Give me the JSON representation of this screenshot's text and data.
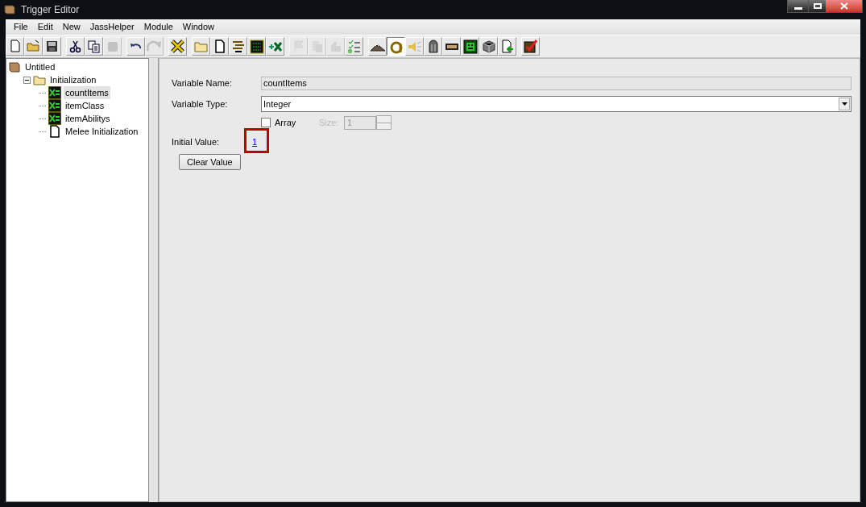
{
  "window": {
    "title": "Trigger Editor"
  },
  "menu": [
    "File",
    "Edit",
    "New",
    "JassHelper",
    "Module",
    "Window"
  ],
  "toolbar": [
    [
      {
        "kind": "new",
        "disabled": false,
        "pressed": false
      },
      {
        "kind": "open",
        "disabled": false,
        "pressed": false
      },
      {
        "kind": "save",
        "disabled": false,
        "pressed": false
      }
    ],
    [
      {
        "kind": "cut",
        "disabled": false,
        "pressed": false
      },
      {
        "kind": "copy",
        "disabled": false,
        "pressed": false
      },
      {
        "kind": "paste",
        "disabled": true,
        "pressed": false
      }
    ],
    [
      {
        "kind": "undo",
        "disabled": false,
        "pressed": false
      },
      {
        "kind": "redo",
        "disabled": true,
        "pressed": false
      }
    ],
    [
      {
        "kind": "cross",
        "disabled": false,
        "pressed": false
      }
    ],
    [
      {
        "kind": "folder",
        "disabled": false,
        "pressed": false
      },
      {
        "kind": "document",
        "disabled": false,
        "pressed": false
      },
      {
        "kind": "lines",
        "disabled": false,
        "pressed": false
      },
      {
        "kind": "binary",
        "disabled": false,
        "pressed": false
      },
      {
        "kind": "plusx",
        "disabled": false,
        "pressed": false
      }
    ],
    [
      {
        "kind": "flag",
        "disabled": true,
        "pressed": false
      },
      {
        "kind": "copydoc",
        "disabled": true,
        "pressed": false
      },
      {
        "kind": "thumb",
        "disabled": true,
        "pressed": false
      },
      {
        "kind": "checklist",
        "disabled": false,
        "pressed": false
      }
    ],
    [
      {
        "kind": "terrain",
        "disabled": false,
        "pressed": false
      },
      {
        "kind": "letter",
        "disabled": false,
        "pressed": true
      },
      {
        "kind": "sound",
        "disabled": false,
        "pressed": false
      },
      {
        "kind": "tomb",
        "disabled": false,
        "pressed": false
      },
      {
        "kind": "strip",
        "disabled": false,
        "pressed": false
      },
      {
        "kind": "face",
        "disabled": false,
        "pressed": false
      },
      {
        "kind": "box",
        "disabled": false,
        "pressed": false
      },
      {
        "kind": "docarrow",
        "disabled": false,
        "pressed": false
      }
    ],
    [
      {
        "kind": "checkbox",
        "disabled": false,
        "pressed": false
      }
    ]
  ],
  "tree": [
    {
      "label": "Untitled",
      "kind": "map",
      "selected": false,
      "children": [
        {
          "label": "Initialization",
          "kind": "folder",
          "selected": false,
          "expanded": true,
          "children": [
            {
              "label": "countItems",
              "kind": "variable",
              "selected": true
            },
            {
              "label": "itemClass",
              "kind": "variable",
              "selected": false
            },
            {
              "label": "itemAbilitys",
              "kind": "variable",
              "selected": false
            },
            {
              "label": "Melee Initialization",
              "kind": "trigger",
              "selected": false
            }
          ]
        }
      ]
    }
  ],
  "form": {
    "name_label": "Variable Name:",
    "name_value": "countItems",
    "type_label": "Variable Type:",
    "type_value": "Integer",
    "array": {
      "label": "Array",
      "checked": false
    },
    "size": {
      "label": "Size:",
      "value": "1",
      "disabled": true
    },
    "initial_label": "Initial Value:",
    "initial_value": "1",
    "clear_button": "Clear Value"
  }
}
